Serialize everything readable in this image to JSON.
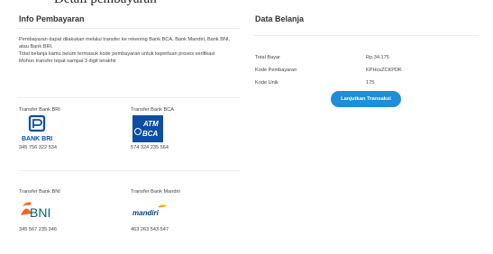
{
  "info": {
    "heading": "Info Pembayaran",
    "lines": [
      "Pembayaran dapat dilakukan melalui transfer ke rekening Bank BCA, Bank Mandiri, Bank BNI, atau Bank BRI.",
      "Total belanja kamu belum termasuk kode pembayaran untuk keperluan proses verifikasi",
      "Mohon transfer tepat sampai 3 digit terakhir"
    ]
  },
  "banks": [
    {
      "label": "Transfer Bank BRI",
      "logo_text": "BANK BRI",
      "account": "345 756 322 534",
      "icon": "bri-logo"
    },
    {
      "label": "Transfer Bank BCA",
      "logo_text": "BCA",
      "account": "574 324 235 564",
      "icon": "bca-logo"
    },
    {
      "label": "Transfer Bank BNI",
      "logo_text": "BNI",
      "account": "345 567 235 346",
      "icon": "bni-logo"
    },
    {
      "label": "Transfer Bank Mandiri",
      "logo_text": "mandiri",
      "account": "463 263 543 547",
      "icon": "mandiri-logo"
    }
  ],
  "summary": {
    "heading": "Data Belanja",
    "rows": [
      {
        "label": "Total Bayar",
        "value": "Rp.34.175"
      },
      {
        "label": "Kode Pembayaran",
        "value": "KPHcsZCKPDK"
      },
      {
        "label": "Kode Unik",
        "value": "175"
      }
    ],
    "button_label": "Lanjutkan Transaksi"
  },
  "colors": {
    "button": "#1e8ed8",
    "bri_blue": "#0a4ea3",
    "bca_blue": "#0b4ea2",
    "bni_orange": "#f26522",
    "bni_teal": "#00656c",
    "mandiri_blue": "#003d79",
    "mandiri_yellow": "#f5a800"
  }
}
